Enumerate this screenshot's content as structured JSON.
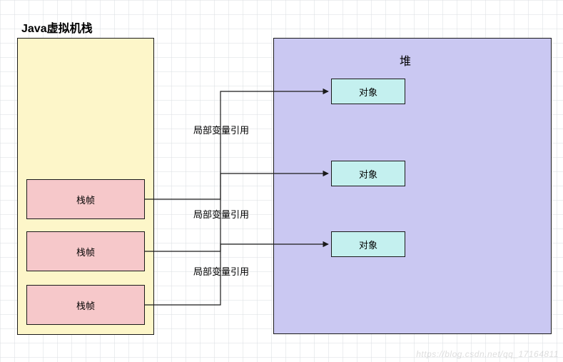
{
  "titles": {
    "stack": "Java虚拟机栈",
    "heap": "堆"
  },
  "stack": {
    "frames": [
      "栈帧",
      "栈帧",
      "栈帧"
    ]
  },
  "heap": {
    "objects": [
      "对象",
      "对象",
      "对象"
    ]
  },
  "edges": {
    "label": "局部变量引用"
  },
  "colors": {
    "stack_bg": "#fdf6c9",
    "frame_bg": "#f6c8ca",
    "heap_bg": "#cac8f2",
    "obj_bg": "#c4f0ef",
    "stroke": "#1a1a1a"
  },
  "watermark": "https://blog.csdn.net/qq_17164811"
}
